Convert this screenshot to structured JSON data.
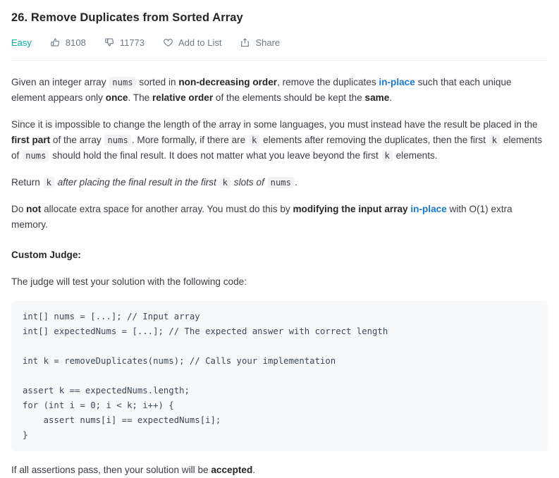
{
  "problem": {
    "title": "26. Remove Duplicates from Sorted Array",
    "difficulty": "Easy",
    "difficulty_color": "#00af9b",
    "likes": "8108",
    "dislikes": "11773",
    "add_to_list_label": "Add to List",
    "share_label": "Share",
    "icons": {
      "like": "thumbs-up-icon",
      "dislike": "thumbs-down-icon",
      "add_to_list": "heart-icon",
      "share": "share-icon"
    }
  },
  "description": {
    "p1": {
      "t1": "Given an integer array ",
      "code1": "nums",
      "t2": " sorted in ",
      "b1": "non-decreasing order",
      "t3": ", remove the duplicates ",
      "link1": "in-place",
      "t4": " such that each unique element appears only ",
      "b2": "once",
      "t5": ". The ",
      "b3": "relative order",
      "t6": " of the elements should be kept the ",
      "b4": "same",
      "t7": "."
    },
    "p2": {
      "t1": "Since it is impossible to change the length of the array in some languages, you must instead have the result be placed in the ",
      "b1": "first part",
      "t2": " of the array ",
      "code1": "nums",
      "t3": ". More formally, if there are ",
      "code2": "k",
      "t4": " elements after removing the duplicates, then the first ",
      "code3": "k",
      "t5": " elements of ",
      "code4": "nums",
      "t6": " should hold the final result. It does not matter what you leave beyond the first ",
      "code5": "k",
      "t7": " elements."
    },
    "p3": {
      "t1": "Return ",
      "code1": "k",
      "em1": " after placing the final result in the first ",
      "code2": "k",
      "em2": " slots of ",
      "code3": "nums",
      "t2": "."
    },
    "p4": {
      "t1": "Do ",
      "b1": "not",
      "t2": " allocate extra space for another array. You must do this by ",
      "b2": "modifying the input array ",
      "link1": "in-place",
      "t3": " with O(1) extra memory."
    },
    "custom_judge_heading": "Custom Judge:",
    "p5": "The judge will test your solution with the following code:",
    "p6": {
      "t1": "If all assertions pass, then your solution will be ",
      "b1": "accepted",
      "t2": "."
    }
  },
  "code_sample": {
    "language": "java",
    "lines": [
      "int[] nums = [...]; // Input array",
      "int[] expectedNums = [...]; // The expected answer with correct length",
      "",
      "int k = removeDuplicates(nums); // Calls your implementation",
      "",
      "assert k == expectedNums.length;",
      "for (int i = 0; i < k; i++) {",
      "    assert nums[i] == expectedNums[i];",
      "}"
    ]
  }
}
